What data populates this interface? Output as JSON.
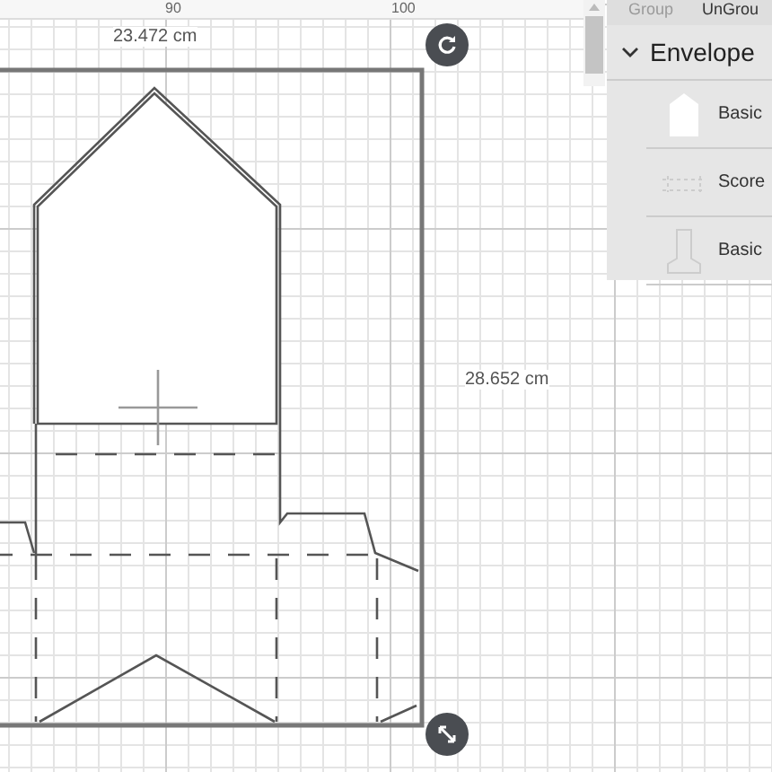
{
  "ruler": {
    "ticks": [
      {
        "label": "90"
      },
      {
        "label": "100"
      }
    ]
  },
  "canvas": {
    "width_label": "23.472 cm",
    "height_label": "28.652 cm"
  },
  "panel": {
    "actions": [
      {
        "label": "Group",
        "disabled": true
      },
      {
        "label": "UnGrou",
        "disabled": false
      }
    ],
    "layers": [
      {
        "name": "Envelope",
        "expanded": true,
        "children": [
          {
            "name": "Basic",
            "kind": "house"
          },
          {
            "name": "Score",
            "kind": "score"
          },
          {
            "name": "Basic",
            "kind": "outline"
          }
        ]
      }
    ]
  }
}
